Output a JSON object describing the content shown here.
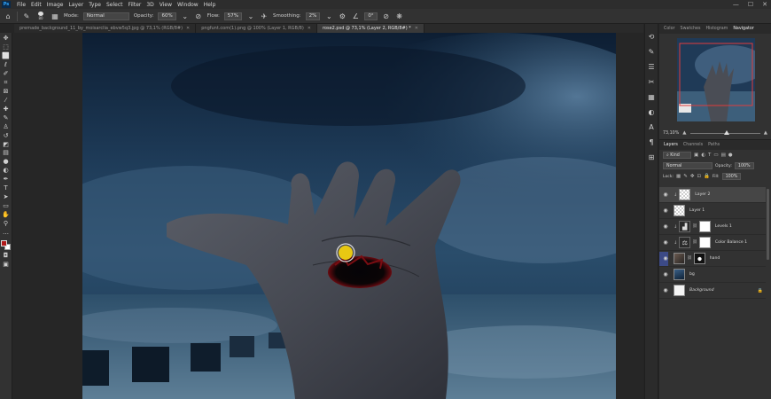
{
  "app": {
    "logo_text": "Ps"
  },
  "menu": [
    "File",
    "Edit",
    "Image",
    "Layer",
    "Type",
    "Select",
    "Filter",
    "3D",
    "View",
    "Window",
    "Help"
  ],
  "window_controls": {
    "minimize": "—",
    "maximize": "☐",
    "close": "✕"
  },
  "options_bar": {
    "brush_size": "80",
    "mode_label": "Mode:",
    "mode_value": "Normal",
    "opacity_label": "Opacity:",
    "opacity_value": "60%",
    "flow_label": "Flow:",
    "flow_value": "57%",
    "smoothing_label": "Smoothing:",
    "smoothing_value": "2%",
    "angle_value": "0°"
  },
  "tabs": [
    {
      "label": "premade_background_11_by_moisarclia_ebvw5q3.jpg @ 73,1% (RGB/8#)",
      "active": false
    },
    {
      "label": "pngfunt.com(1).png @ 100% (Layer 1, RGB/8)",
      "active": false
    },
    {
      "label": "rose2.psd @ 73,1% (Layer 2, RGB/8#) *",
      "active": true
    }
  ],
  "navigator": {
    "tabs": [
      "Color",
      "Swatches",
      "Histogram",
      "Navigator"
    ],
    "active_tab": "Navigator",
    "zoom": "73,10%"
  },
  "layers_panel": {
    "tabs": [
      "Layers",
      "Channels",
      "Paths"
    ],
    "active_tab": "Layers",
    "filter_kind": "Kind",
    "blend_mode": "Normal",
    "opacity_label": "Opacity:",
    "opacity_value": "100%",
    "lock_label": "Lock:",
    "fill_label": "Fill:",
    "fill_value": "100%",
    "layers": [
      {
        "name": "Layer 2",
        "thumb": "checker",
        "selected": true,
        "visible": true
      },
      {
        "name": "Layer 1",
        "thumb": "checker",
        "selected": false,
        "visible": true
      },
      {
        "name": "Levels 1",
        "thumb": "adj-levels",
        "mask": true,
        "clipped": true,
        "visible": true
      },
      {
        "name": "Color Balance 1",
        "thumb": "adj-balance",
        "mask": true,
        "clipped": true,
        "visible": true
      },
      {
        "name": "hand",
        "thumb": "photo",
        "mask": true,
        "mask_dark": true,
        "visible": true
      },
      {
        "name": "bg",
        "thumb": "blue",
        "visible": true
      },
      {
        "name": "Background",
        "thumb": "white",
        "visible": true,
        "locked": true
      }
    ]
  },
  "tool_icons": [
    "move-tool",
    "artboard-tool",
    "marquee-tool",
    "lasso-tool",
    "quick-select-tool",
    "crop-tool",
    "frame-tool",
    "eyedropper-tool",
    "healing-brush-tool",
    "brush-tool",
    "clone-stamp-tool",
    "history-brush-tool",
    "eraser-tool",
    "gradient-tool",
    "blur-tool",
    "dodge-tool",
    "pen-tool",
    "type-tool",
    "path-select-tool",
    "rectangle-tool",
    "hand-tool",
    "zoom-tool",
    "more-tools"
  ],
  "colors": {
    "foreground": "#b01818",
    "background": "#ffffff",
    "accent_selection": "#3c4a86"
  }
}
